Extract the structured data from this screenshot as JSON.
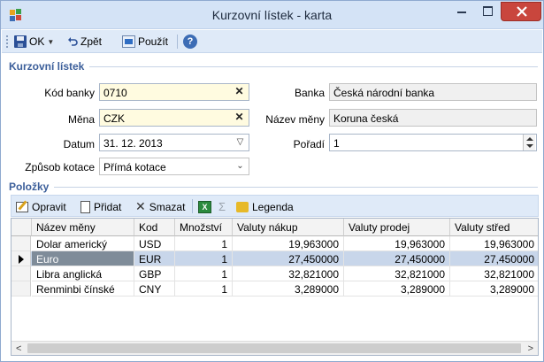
{
  "window": {
    "title": "Kurzovní lístek - karta"
  },
  "toolbar": {
    "ok_label": "OK",
    "back_label": "Zpět",
    "apply_label": "Použít",
    "help_symbol": "?"
  },
  "form": {
    "section_title": "Kurzovní lístek",
    "bank_code": {
      "label": "Kód banky",
      "value": "0710"
    },
    "currency": {
      "label": "Měna",
      "value": "CZK"
    },
    "date": {
      "label": "Datum",
      "value": "31. 12. 2013"
    },
    "quote_method": {
      "label": "Způsob kotace",
      "value": "Přímá kotace"
    },
    "bank": {
      "label": "Banka",
      "value": "Česká národní banka"
    },
    "currency_name": {
      "label": "Název měny",
      "value": "Koruna česká"
    },
    "order": {
      "label": "Pořadí",
      "value": "1"
    }
  },
  "items": {
    "section_title": "Položky",
    "toolbar": {
      "edit_label": "Opravit",
      "add_label": "Přidat",
      "delete_label": "Smazat",
      "excel_symbol": "X",
      "sigma_symbol": "Σ",
      "legend_label": "Legenda"
    },
    "columns": [
      "Název měny",
      "Kod",
      "Množství",
      "Valuty nákup",
      "Valuty prodej",
      "Valuty střed"
    ],
    "rows": [
      {
        "name": "Dolar americký",
        "code": "USD",
        "qty": "1",
        "buy": "19,963000",
        "sell": "19,963000",
        "mid": "19,963000"
      },
      {
        "name": "Euro",
        "code": "EUR",
        "qty": "1",
        "buy": "27,450000",
        "sell": "27,450000",
        "mid": "27,450000"
      },
      {
        "name": "Libra anglická",
        "code": "GBP",
        "qty": "1",
        "buy": "32,821000",
        "sell": "32,821000",
        "mid": "32,821000"
      },
      {
        "name": "Renminbi čínské",
        "code": "CNY",
        "qty": "1",
        "buy": "3,289000",
        "sell": "3,289000",
        "mid": "3,289000"
      }
    ],
    "selected_row": 1
  },
  "colors": {
    "accent": "#3b5e9a",
    "title_bar": "#d4e3f6",
    "required_field": "#fffbe0",
    "selected_row": "#c8d6ea",
    "close_button": "#c9463d"
  }
}
